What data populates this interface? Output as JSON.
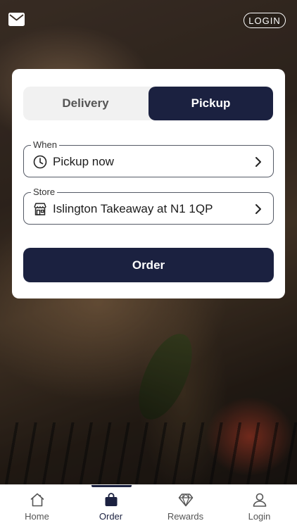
{
  "header": {
    "mail_icon": "envelope-icon",
    "login_label": "LOGIN"
  },
  "order_card": {
    "mode_tabs": [
      {
        "label": "Delivery",
        "selected": false
      },
      {
        "label": "Pickup",
        "selected": true
      }
    ],
    "when": {
      "label": "When",
      "value": "Pickup now",
      "icon": "clock-icon"
    },
    "store": {
      "label": "Store",
      "value": "Islington Takeaway at N1 1QP",
      "icon": "storefront-icon"
    },
    "order_button_label": "Order"
  },
  "tab_bar": {
    "active": "Order",
    "items": [
      {
        "label": "Home",
        "icon": "home-icon"
      },
      {
        "label": "Order",
        "icon": "shopping-bag-icon"
      },
      {
        "label": "Rewards",
        "icon": "diamond-icon"
      },
      {
        "label": "Login",
        "icon": "user-icon"
      }
    ]
  },
  "colors": {
    "primary": "#1b2140",
    "card_background": "#ffffff",
    "segment_background": "#f1f1f1"
  }
}
